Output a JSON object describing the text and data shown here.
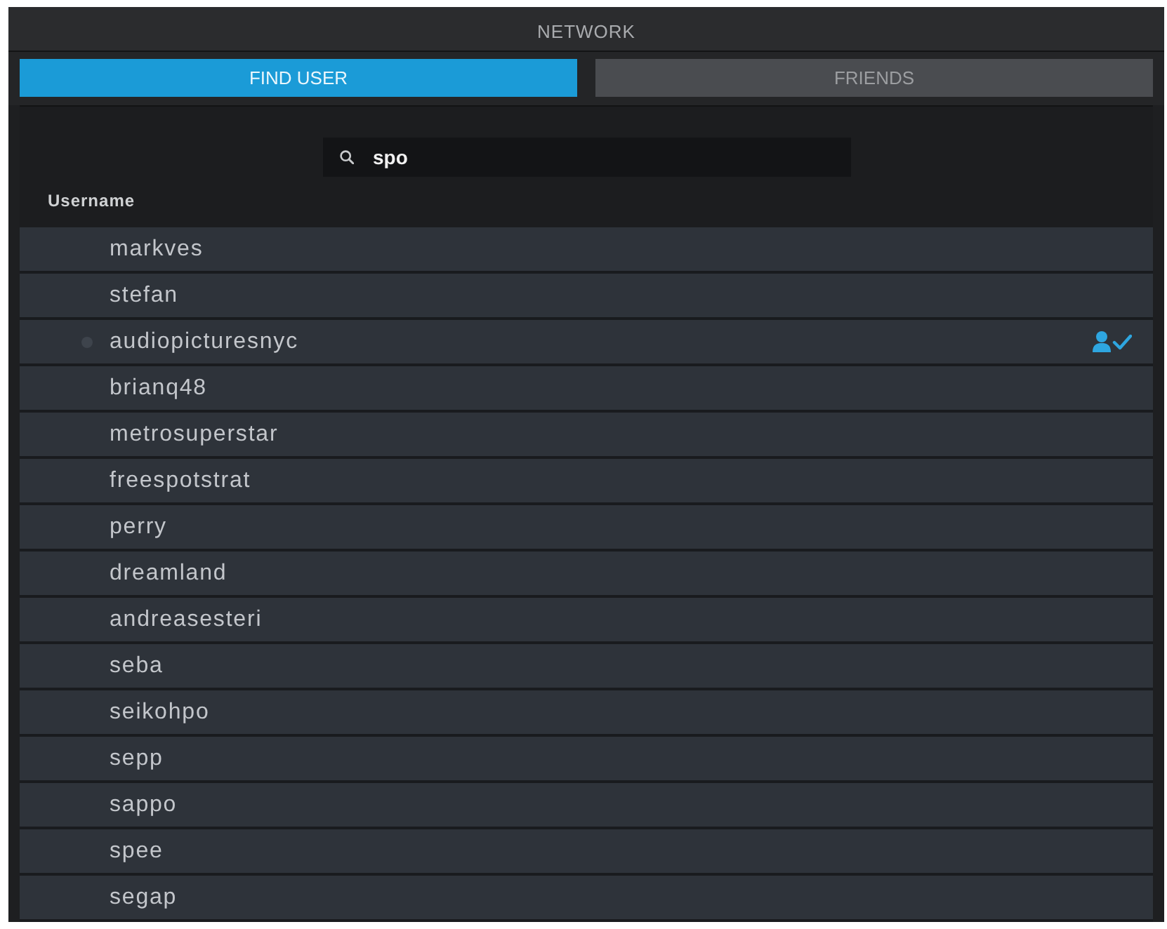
{
  "window": {
    "title": "NETWORK"
  },
  "tabs": [
    {
      "label": "FIND USER",
      "selected": true
    },
    {
      "label": "FRIENDS",
      "selected": false
    }
  ],
  "search": {
    "value": "spo"
  },
  "table": {
    "columns": [
      "Username"
    ]
  },
  "users": [
    {
      "name": "markves",
      "status_dot": false,
      "friend": false
    },
    {
      "name": "stefan",
      "status_dot": false,
      "friend": false
    },
    {
      "name": "audiopicturesnyc",
      "status_dot": true,
      "friend": true
    },
    {
      "name": "brianq48",
      "status_dot": false,
      "friend": false
    },
    {
      "name": "metrosuperstar",
      "status_dot": false,
      "friend": false
    },
    {
      "name": "freespotstrat",
      "status_dot": false,
      "friend": false
    },
    {
      "name": "perry",
      "status_dot": false,
      "friend": false
    },
    {
      "name": "dreamland",
      "status_dot": false,
      "friend": false
    },
    {
      "name": "andreasesteri",
      "status_dot": false,
      "friend": false
    },
    {
      "name": "seba",
      "status_dot": false,
      "friend": false
    },
    {
      "name": "seikohpo",
      "status_dot": false,
      "friend": false
    },
    {
      "name": "sepp",
      "status_dot": false,
      "friend": false
    },
    {
      "name": "sappo",
      "status_dot": false,
      "friend": false
    },
    {
      "name": "spee",
      "status_dot": false,
      "friend": false
    },
    {
      "name": "segap",
      "status_dot": false,
      "friend": false
    }
  ]
}
